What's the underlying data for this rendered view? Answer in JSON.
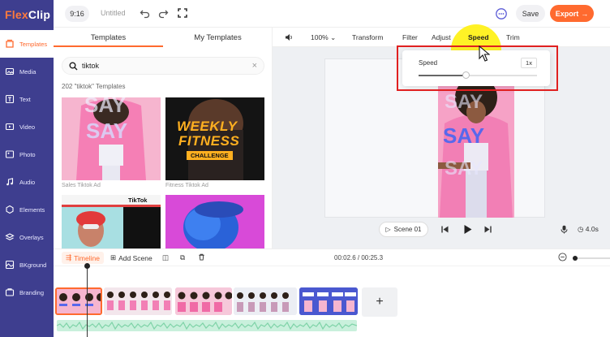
{
  "app": {
    "logo_flex": "Flex",
    "logo_clip": "Clip"
  },
  "topbar": {
    "ratio": "9:16",
    "title": "Untitled",
    "save": "Save",
    "export": "Export"
  },
  "rail": {
    "items": [
      {
        "label": "Templates",
        "icon": "templates-icon"
      },
      {
        "label": "Media",
        "icon": "media-icon"
      },
      {
        "label": "Text",
        "icon": "text-icon"
      },
      {
        "label": "Video",
        "icon": "video-icon"
      },
      {
        "label": "Photo",
        "icon": "photo-icon"
      },
      {
        "label": "Audio",
        "icon": "audio-icon"
      },
      {
        "label": "Elements",
        "icon": "elements-icon"
      },
      {
        "label": "Overlays",
        "icon": "overlays-icon"
      },
      {
        "label": "BKground",
        "icon": "background-icon"
      },
      {
        "label": "Branding",
        "icon": "branding-icon"
      }
    ]
  },
  "templates": {
    "tabs": [
      "Templates",
      "My Templates"
    ],
    "search_value": "tiktok",
    "count": "202 \"tiktok\" Templates",
    "cards": [
      {
        "label": "Sales Tiktok Ad",
        "art": "SAY"
      },
      {
        "label": "Fitness Tiktok Ad",
        "art_line1": "WEEKLY",
        "art_line2": "FITNESS",
        "art_tag": "CHALLENGE"
      },
      {
        "label": "",
        "art": "TikTok"
      },
      {
        "label": ""
      }
    ]
  },
  "canvas_toolbar": {
    "zoom": "100%",
    "items": [
      "Transform",
      "Filter",
      "Adjust",
      "Speed",
      "Trim"
    ],
    "active": "Speed"
  },
  "speed_panel": {
    "label": "Speed",
    "value": "1x",
    "slider_fraction": 0.4
  },
  "preview": {
    "art": "SAY"
  },
  "playback": {
    "scene": "Scene 01",
    "duration": "4.0s"
  },
  "timeline": {
    "label": "Timeline",
    "add_scene": "Add Scene",
    "time": "00:02.6 / 00:25.3"
  },
  "colors": {
    "rail_bg": "#3e3e8f",
    "accent": "#ff6a2f",
    "highlight": "#fff000",
    "callout": "#e02020"
  }
}
